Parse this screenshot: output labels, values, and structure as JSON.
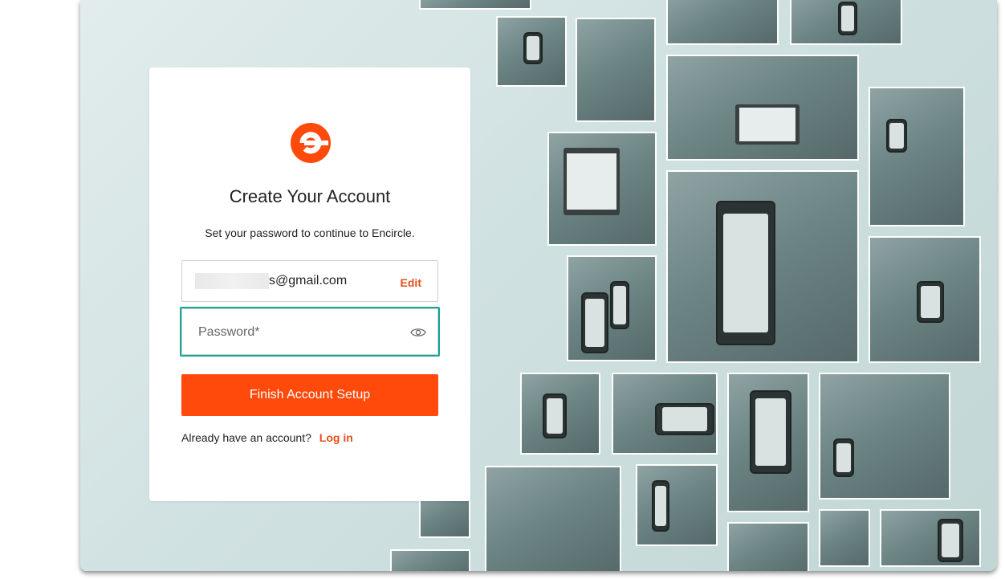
{
  "card": {
    "title": "Create Your Account",
    "subtitle": "Set your password to continue to Encircle.",
    "email_visible": "s@gmail.com",
    "edit_label": "Edit",
    "password_placeholder": "Password*",
    "submit_label": "Finish Account Setup",
    "login_prompt": "Already have an account?",
    "login_link": "Log in"
  },
  "colors": {
    "brand": "#ff4a0c",
    "focus_highlight": "#12a797",
    "background": "#d0e1e1"
  },
  "icons": {
    "logo": "encircle-logo",
    "password_toggle": "eye-icon"
  }
}
